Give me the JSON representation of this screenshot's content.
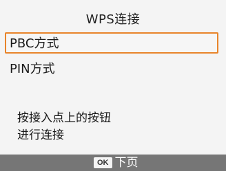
{
  "screen": {
    "title": "WPS连接"
  },
  "options": [
    {
      "label": "PBC方式",
      "selected": true
    },
    {
      "label": "PIN方式",
      "selected": false
    }
  ],
  "message": {
    "line1": "按接入点上的按钮",
    "line2": "进行连接"
  },
  "footer": {
    "ok_key": "OK",
    "ok_action": "下页"
  },
  "colors": {
    "selection_border": "#e8842a",
    "footer_bg": "#767676"
  }
}
